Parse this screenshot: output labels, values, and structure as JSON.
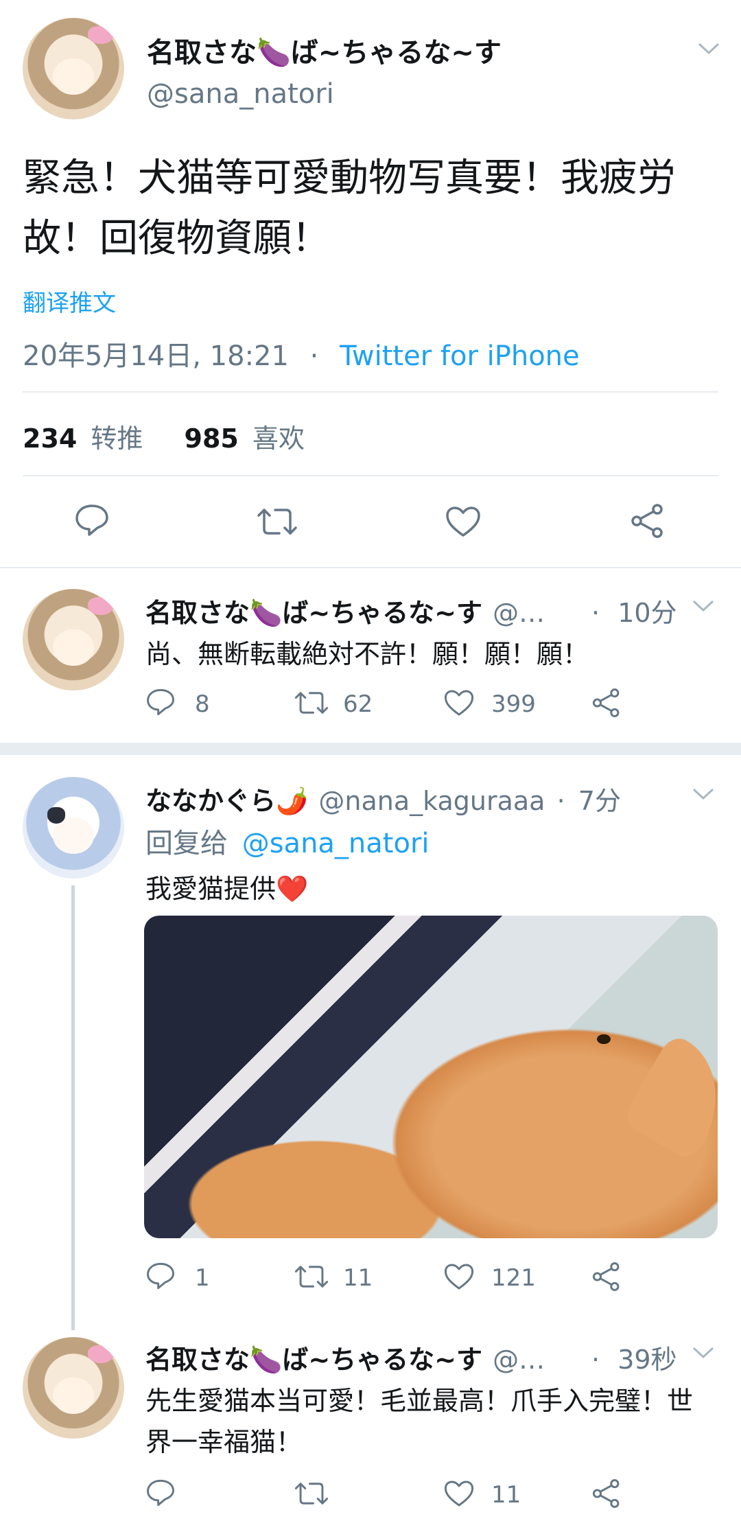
{
  "main_tweet": {
    "author_name": "名取さな🍆ば~ちゃるな~す",
    "author_handle": "@sana_natori",
    "text": "緊急！犬猫等可愛動物写真要！我疲労故！回復物資願！",
    "translate_label": "翻译推文",
    "timestamp": "20年5月14日, 18:21",
    "separator": "·",
    "source": "Twitter for iPhone",
    "retweets": "234",
    "retweets_label": "转推",
    "likes": "985",
    "likes_label": "喜欢"
  },
  "replies": [
    {
      "author_name": "名取さな🍆ば~ちゃるな~す",
      "author_handle": "@…",
      "time": "10分",
      "text": "尚、無断転載絶対不許！願！願！願！",
      "reply_count": "8",
      "retweet_count": "62",
      "like_count": "399"
    },
    {
      "author_name": "ななかぐら🌶️",
      "author_handle": "@nana_kaguraaa",
      "time": "7分",
      "reply_to_label": "回复给",
      "reply_to_handle": "@sana_natori",
      "text": "我愛猫提供❤️",
      "reply_count": "1",
      "retweet_count": "11",
      "like_count": "121"
    },
    {
      "author_name": "名取さな🍆ば~ちゃるな~す",
      "author_handle": "@…",
      "time": "39秒",
      "text_line1": "先生愛猫本当可愛！毛並最高！爪手入完璧！世",
      "text_line2": "界一幸福猫！",
      "reply_count": "",
      "retweet_count": "",
      "like_count": "11"
    }
  ],
  "colors": {
    "link": "#1da1f2",
    "secondary_text": "#657786",
    "divider": "#e6ecf0"
  },
  "icons": [
    "chevron-down-icon",
    "reply-icon",
    "retweet-icon",
    "like-icon",
    "share-icon"
  ]
}
